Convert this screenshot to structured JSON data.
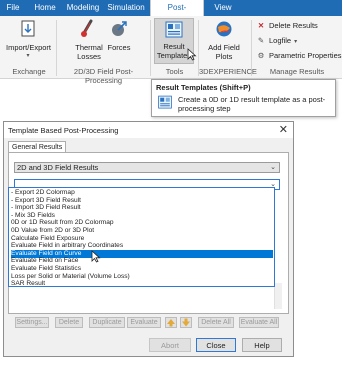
{
  "ribbon": {
    "tabs": [
      "File",
      "Home",
      "Modeling",
      "Simulation",
      "Post-Processing",
      "View"
    ],
    "active_tab": "Post-Processing",
    "buttons": {
      "import_export": "Import/Export",
      "thermal_losses_1": "Thermal",
      "thermal_losses_2": "Losses",
      "forces": "Forces",
      "result_templates_1": "Result",
      "result_templates_2": "Templates",
      "add_field_plots_1": "Add Field",
      "add_field_plots_2": "Plots"
    },
    "small_items": {
      "delete_results": "Delete Results",
      "logfile": "Logfile",
      "parametric_properties": "Parametric Properties"
    },
    "groups": [
      "Exchange",
      "2D/3D Field Post-Processing",
      "Tools",
      "3DEXPERIENCE",
      "Manage Results"
    ]
  },
  "tooltip": {
    "title": "Result Templates (Shift+P)",
    "description": "Create a 0D or 1D result template as a post-processing step"
  },
  "dialog": {
    "title": "Template Based Post-Processing",
    "tab": "General Results",
    "category_value": "2D and 3D Field Results",
    "template_value": "",
    "options": [
      "- Export 2D Colormap",
      "- Export 3D Field Result",
      "- Import 3D Field Result",
      "- Mix 3D Fields",
      "0D or 1D Result from 2D Colormap",
      "0D Value from 2D or 3D Plot",
      "Calculate Field Exposure",
      "Evaluate Field in arbitrary Coordinates",
      "Evaluate Field on Curve",
      "Evaluate Field on Face",
      "Evaluate Field Statistics",
      "Loss per Solid or Material (Volume Loss)",
      "SAR Result"
    ],
    "selected_option": "Evaluate Field on Curve",
    "action_buttons": {
      "settings": "Settings...",
      "delete": "Delete",
      "duplicate": "Duplicate",
      "evaluate": "Evaluate",
      "delete_all": "Delete All",
      "evaluate_all": "Evaluate All"
    },
    "bottom_buttons": {
      "abort": "Abort",
      "close": "Close",
      "help": "Help"
    }
  },
  "colors": {
    "ribbon_blue": "#1f6cb5",
    "selection_blue": "#0078d7",
    "delete_red": "#c0282d"
  }
}
